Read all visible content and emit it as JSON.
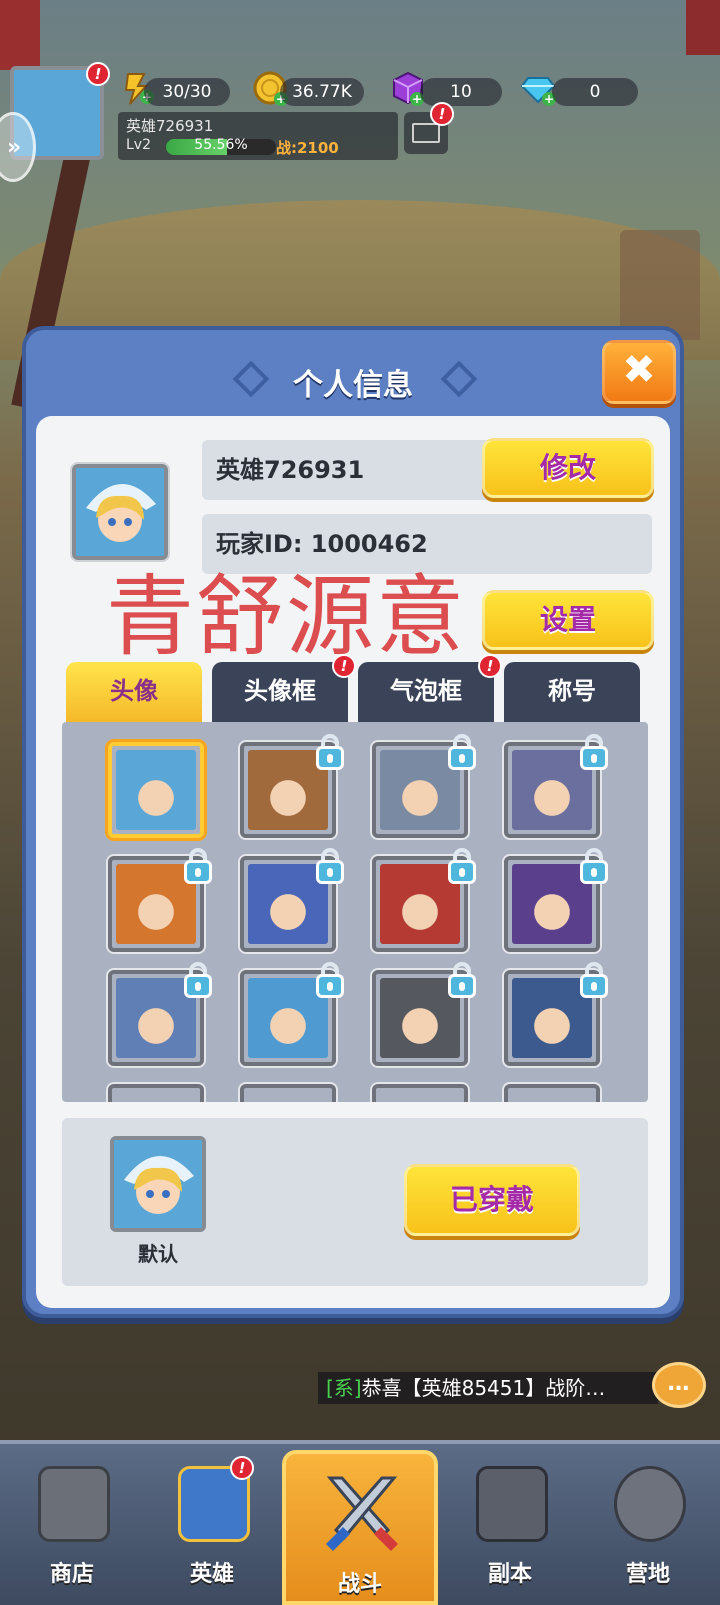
{
  "top_bar": {
    "stamina": "30/30",
    "gold": "36.77K",
    "cube": "10",
    "diamond": "0",
    "player_name": "英雄726931",
    "level": "Lv2",
    "exp_text": "55.56%",
    "exp_fraction": 0.5556,
    "power": "战:2100"
  },
  "modal": {
    "title": "个人信息",
    "close_label": "✖",
    "name_value": "英雄726931",
    "edit_button": "修改",
    "id_value": "玩家ID:  1000462",
    "settings_button": "设置",
    "watermark": "青舒源意",
    "tabs": [
      {
        "label": "头像",
        "active": true,
        "alert": false
      },
      {
        "label": "头像框",
        "active": false,
        "alert": true
      },
      {
        "label": "气泡框",
        "active": false,
        "alert": true
      },
      {
        "label": "称号",
        "active": false,
        "alert": false
      }
    ],
    "avatars": [
      {
        "name": "blonde-mage",
        "locked": false,
        "selected": true,
        "color": "#5aa6d6"
      },
      {
        "name": "minotaur",
        "locked": true,
        "selected": false,
        "color": "#a06a3c"
      },
      {
        "name": "armored-undead",
        "locked": true,
        "selected": false,
        "color": "#7b8aa3"
      },
      {
        "name": "dark-elf",
        "locked": true,
        "selected": false,
        "color": "#6a6f9e"
      },
      {
        "name": "fire-queen",
        "locked": true,
        "selected": false,
        "color": "#d5762f"
      },
      {
        "name": "dragon-knight",
        "locked": true,
        "selected": false,
        "color": "#4a66b8"
      },
      {
        "name": "red-mech",
        "locked": true,
        "selected": false,
        "color": "#b53a33"
      },
      {
        "name": "purple-ninja",
        "locked": true,
        "selected": false,
        "color": "#5a3f8c"
      },
      {
        "name": "old-wizard",
        "locked": true,
        "selected": false,
        "color": "#5f7fb5"
      },
      {
        "name": "blonde-mage-alt",
        "locked": true,
        "selected": false,
        "color": "#4f9bd1"
      },
      {
        "name": "horned-sage",
        "locked": true,
        "selected": false,
        "color": "#55585f"
      },
      {
        "name": "pirate-captain",
        "locked": true,
        "selected": false,
        "color": "#3c5a8e"
      }
    ],
    "equipped_label": "默认",
    "wearing_button": "已穿戴"
  },
  "chat": {
    "tag": "[系]",
    "message": "恭喜【英雄85451】战阶…",
    "button_label": "…"
  },
  "nav": [
    {
      "label": "商店",
      "active": false,
      "alert": false
    },
    {
      "label": "英雄",
      "active": false,
      "alert": true
    },
    {
      "label": "战斗",
      "active": true,
      "alert": false
    },
    {
      "label": "副本",
      "active": false,
      "alert": false
    },
    {
      "label": "营地",
      "active": false,
      "alert": false
    }
  ],
  "colors": {
    "modal_blue": "#5d80c4",
    "button_yellow": "#ffe43a",
    "button_text_purple": "#a42aa8",
    "alert_red": "#e02532",
    "watermark_red": "#d62828"
  }
}
